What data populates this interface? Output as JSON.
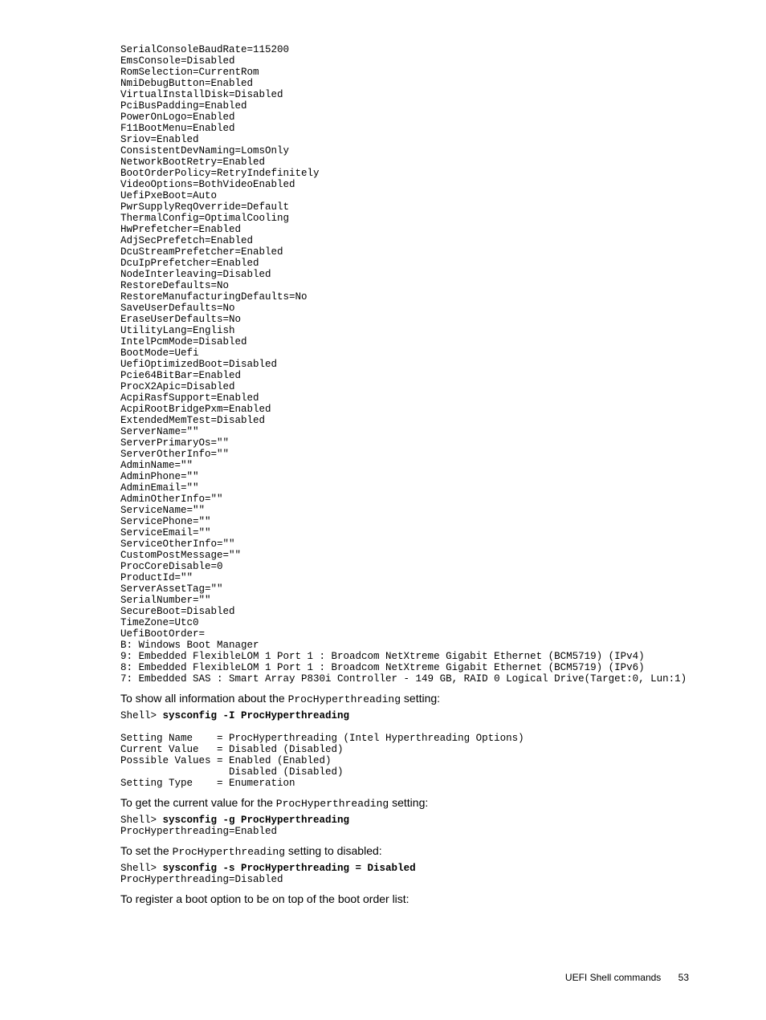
{
  "config_block": "SerialConsoleBaudRate=115200\nEmsConsole=Disabled\nRomSelection=CurrentRom\nNmiDebugButton=Enabled\nVirtualInstallDisk=Disabled\nPciBusPadding=Enabled\nPowerOnLogo=Enabled\nF11BootMenu=Enabled\nSriov=Enabled\nConsistentDevNaming=LomsOnly\nNetworkBootRetry=Enabled\nBootOrderPolicy=RetryIndefinitely\nVideoOptions=BothVideoEnabled\nUefiPxeBoot=Auto\nPwrSupplyReqOverride=Default\nThermalConfig=OptimalCooling\nHwPrefetcher=Enabled\nAdjSecPrefetch=Enabled\nDcuStreamPrefetcher=Enabled\nDcuIpPrefetcher=Enabled\nNodeInterleaving=Disabled\nRestoreDefaults=No\nRestoreManufacturingDefaults=No\nSaveUserDefaults=No\nEraseUserDefaults=No\nUtilityLang=English\nIntelPcmMode=Disabled\nBootMode=Uefi\nUefiOptimizedBoot=Disabled\nPcie64BitBar=Enabled\nProcX2Apic=Disabled\nAcpiRasfSupport=Enabled\nAcpiRootBridgePxm=Enabled\nExtendedMemTest=Disabled\nServerName=\"\"\nServerPrimaryOs=\"\"\nServerOtherInfo=\"\"\nAdminName=\"\"\nAdminPhone=\"\"\nAdminEmail=\"\"\nAdminOtherInfo=\"\"\nServiceName=\"\"\nServicePhone=\"\"\nServiceEmail=\"\"\nServiceOtherInfo=\"\"\nCustomPostMessage=\"\"\nProcCoreDisable=0\nProductId=\"\"\nServerAssetTag=\"\"\nSerialNumber=\"\"\nSecureBoot=Disabled\nTimeZone=Utc0\nUefiBootOrder=\nB: Windows Boot Manager\n9: Embedded FlexibleLOM 1 Port 1 : Broadcom NetXtreme Gigabit Ethernet (BCM5719) (IPv4)\n8: Embedded FlexibleLOM 1 Port 1 : Broadcom NetXtreme Gigabit Ethernet (BCM5719) (IPv6)\n7: Embedded SAS : Smart Array P830i Controller - 149 GB, RAID 0 Logical Drive(Target:0, Lun:1)",
  "narr": {
    "show_all_pre": "To show all information about the ",
    "show_all_mono": "ProcHyperthreading",
    "show_all_post": " setting:"
  },
  "cmd1": {
    "prompt": "Shell> ",
    "cmd": "sysconfig -I ProcHyperthreading",
    "output": "Setting Name    = ProcHyperthreading (Intel Hyperthreading Options)\nCurrent Value   = Disabled (Disabled)\nPossible Values = Enabled (Enabled)\n                  Disabled (Disabled)\nSetting Type    = Enumeration"
  },
  "narr2": {
    "pre": "To get the current value for the ",
    "mono": "ProcHyperthreading",
    "post": " setting:"
  },
  "cmd2": {
    "prompt": "Shell> ",
    "cmd": "sysconfig -g ProcHyperthreading",
    "output": "ProcHyperthreading=Enabled"
  },
  "narr3": {
    "pre": "To set the ",
    "mono": "ProcHyperthreading",
    "post": " setting to disabled:"
  },
  "cmd3": {
    "prompt": "Shell> ",
    "cmd": "sysconfig -s ProcHyperthreading = Disabled",
    "output": "ProcHyperthreading=Disabled"
  },
  "narr4": "To register a boot option to be on top of the boot order list:",
  "footer": {
    "section": "UEFI Shell commands",
    "page": "53"
  }
}
